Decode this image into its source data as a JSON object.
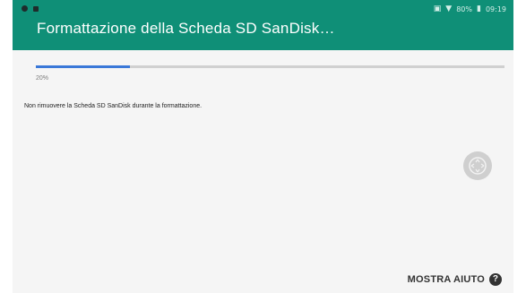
{
  "status_bar": {
    "left_icons": [
      "dot-icon",
      "sim-icon"
    ],
    "battery": "80%",
    "time": "09:19",
    "right_icons": [
      "vibration-icon",
      "wifi-icon",
      "battery-icon"
    ]
  },
  "header": {
    "title": "Formattazione della Scheda SD SanDisk…",
    "color": "#0f8f77"
  },
  "progress": {
    "value": 20,
    "label": "20%",
    "color": "#3a78d8"
  },
  "content": {
    "message": "Non rimuovere la Scheda SD SanDisk durante la formattazione."
  },
  "footer": {
    "help_label": "MOSTRA AIUTO",
    "help_icon": "?"
  }
}
